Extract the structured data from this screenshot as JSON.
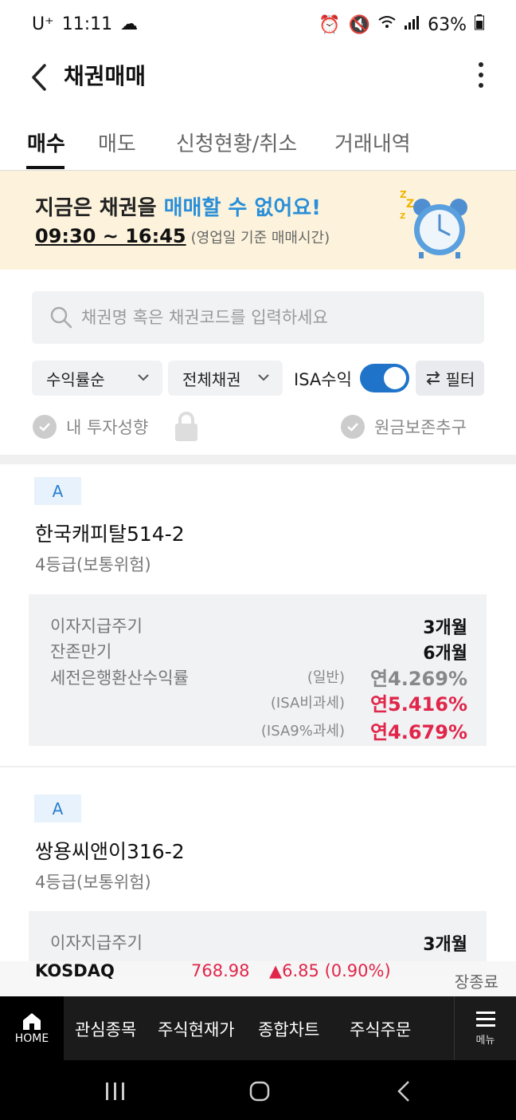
{
  "status_bar": {
    "carrier": "U⁺",
    "time": "11:11",
    "battery": "63%"
  },
  "header": {
    "title": "채권매매"
  },
  "tabs": [
    {
      "label": "매수",
      "active": true
    },
    {
      "label": "매도",
      "active": false
    },
    {
      "label": "신청현황/취소",
      "active": false
    },
    {
      "label": "거래내역",
      "active": false
    }
  ],
  "notice": {
    "line1_prefix": "지금은 채권을 ",
    "line1_highlight": "매매할 수 없어요!",
    "time_range": "09:30 ~ 16:45",
    "time_note": "(영업일 기준 매매시간)"
  },
  "search": {
    "placeholder": "채권명 혹은 채권코드를 입력하세요"
  },
  "filters": {
    "sort": "수익률순",
    "bond_type": "전체채권",
    "isa_label": "ISA수익",
    "isa_on": true,
    "filter_button": "필터"
  },
  "checks": {
    "my_profile": "내 투자성향",
    "principal": "원금보존추구"
  },
  "bonds": [
    {
      "grade": "A",
      "name": "한국캐피탈514-2",
      "risk": "4등급(보통위험)",
      "labels": {
        "interest_cycle": "이자지급주기",
        "remaining": "잔존만기",
        "yield_title": "세전은행환산수익률"
      },
      "interest_cycle": "3개월",
      "remaining": "6개월",
      "yields": [
        {
          "type": "(일반)",
          "value": "연4.269%"
        },
        {
          "type": "(ISA비과세)",
          "value": "연5.416%"
        },
        {
          "type": "(ISA9%과세)",
          "value": "연4.679%"
        }
      ]
    },
    {
      "grade": "A",
      "name": "쌍용씨앤이316-2",
      "risk": "4등급(보통위험)",
      "labels": {
        "interest_cycle": "이자지급주기"
      },
      "interest_cycle": "3개월"
    }
  ],
  "ticker": {
    "name": "KOSDAQ",
    "value": "768.98",
    "change": "▲6.85 (0.90%)",
    "close_label": "장종료"
  },
  "bottom_nav": {
    "home": "HOME",
    "items": [
      "관심종목",
      "주식현재가",
      "종합차트",
      "주식주문"
    ],
    "menu": "메뉴"
  },
  "colors": {
    "accent_blue": "#2a8fd8",
    "toggle_blue": "#1f73c8",
    "red": "#e0264a",
    "notice_bg": "#fdf3dc"
  }
}
